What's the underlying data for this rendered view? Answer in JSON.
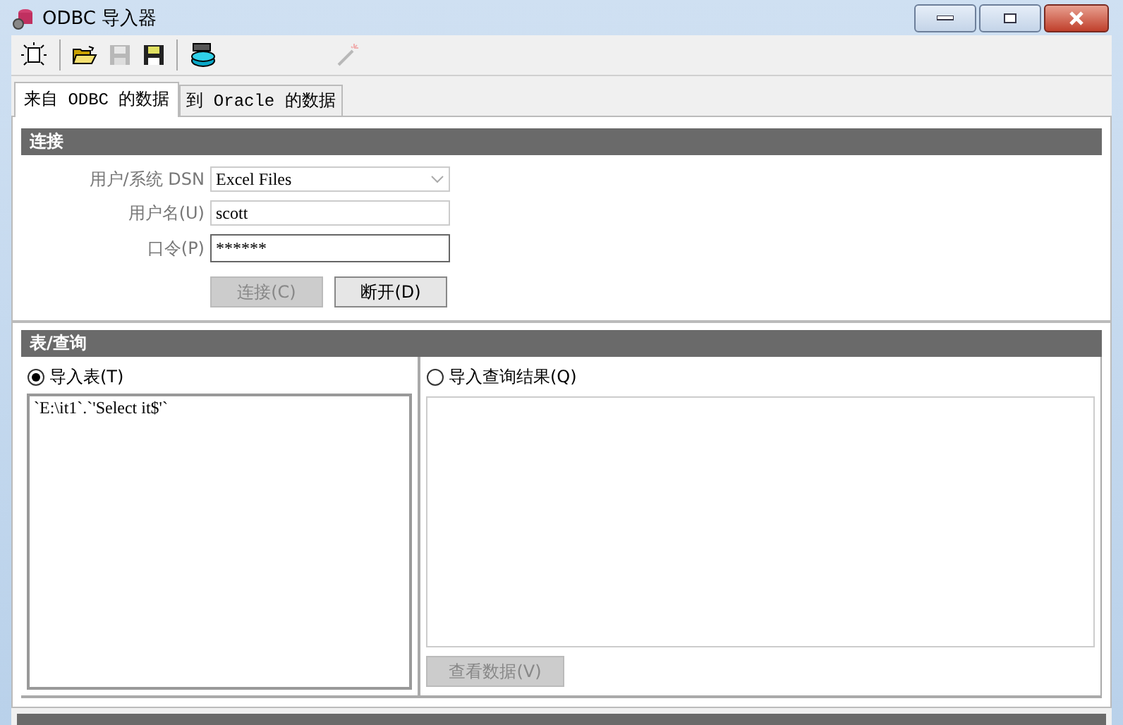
{
  "window": {
    "title": "ODBC 导入器"
  },
  "toolbar": [
    {
      "kind": "new",
      "disabled": false
    },
    {
      "kind": "separator"
    },
    {
      "kind": "open",
      "disabled": false
    },
    {
      "kind": "save",
      "disabled": true
    },
    {
      "kind": "saveas",
      "disabled": false
    },
    {
      "kind": "separator"
    },
    {
      "kind": "database",
      "disabled": false
    },
    {
      "kind": "wand",
      "disabled": true
    }
  ],
  "tabs": [
    {
      "label": "来自 ODBC 的数据",
      "selected": true
    },
    {
      "label": "到 Oracle 的数据",
      "selected": false
    }
  ],
  "connection": {
    "title": "连接",
    "fields": [
      {
        "label": "用户/系统 DSN",
        "kind": "dropdown",
        "value": "Excel Files",
        "disabled": true
      },
      {
        "label": "用户名(U)",
        "kind": "text",
        "value": "scott",
        "disabled": true
      },
      {
        "label": "口令(P)",
        "kind": "password",
        "value": "******",
        "disabled": false
      }
    ],
    "buttons": [
      {
        "label": "连接(C)",
        "disabled": true
      },
      {
        "label": "断开(D)",
        "disabled": false
      }
    ]
  },
  "table_query": {
    "title": "表/查询",
    "options": [
      {
        "label": "导入表(T)",
        "selected": true,
        "items": [
          "`E:\\it1`.`'Select it$'`"
        ]
      },
      {
        "label": "导入查询结果(Q)",
        "selected": false,
        "button": {
          "label": "查看数据(V)",
          "disabled": true
        }
      }
    ]
  }
}
